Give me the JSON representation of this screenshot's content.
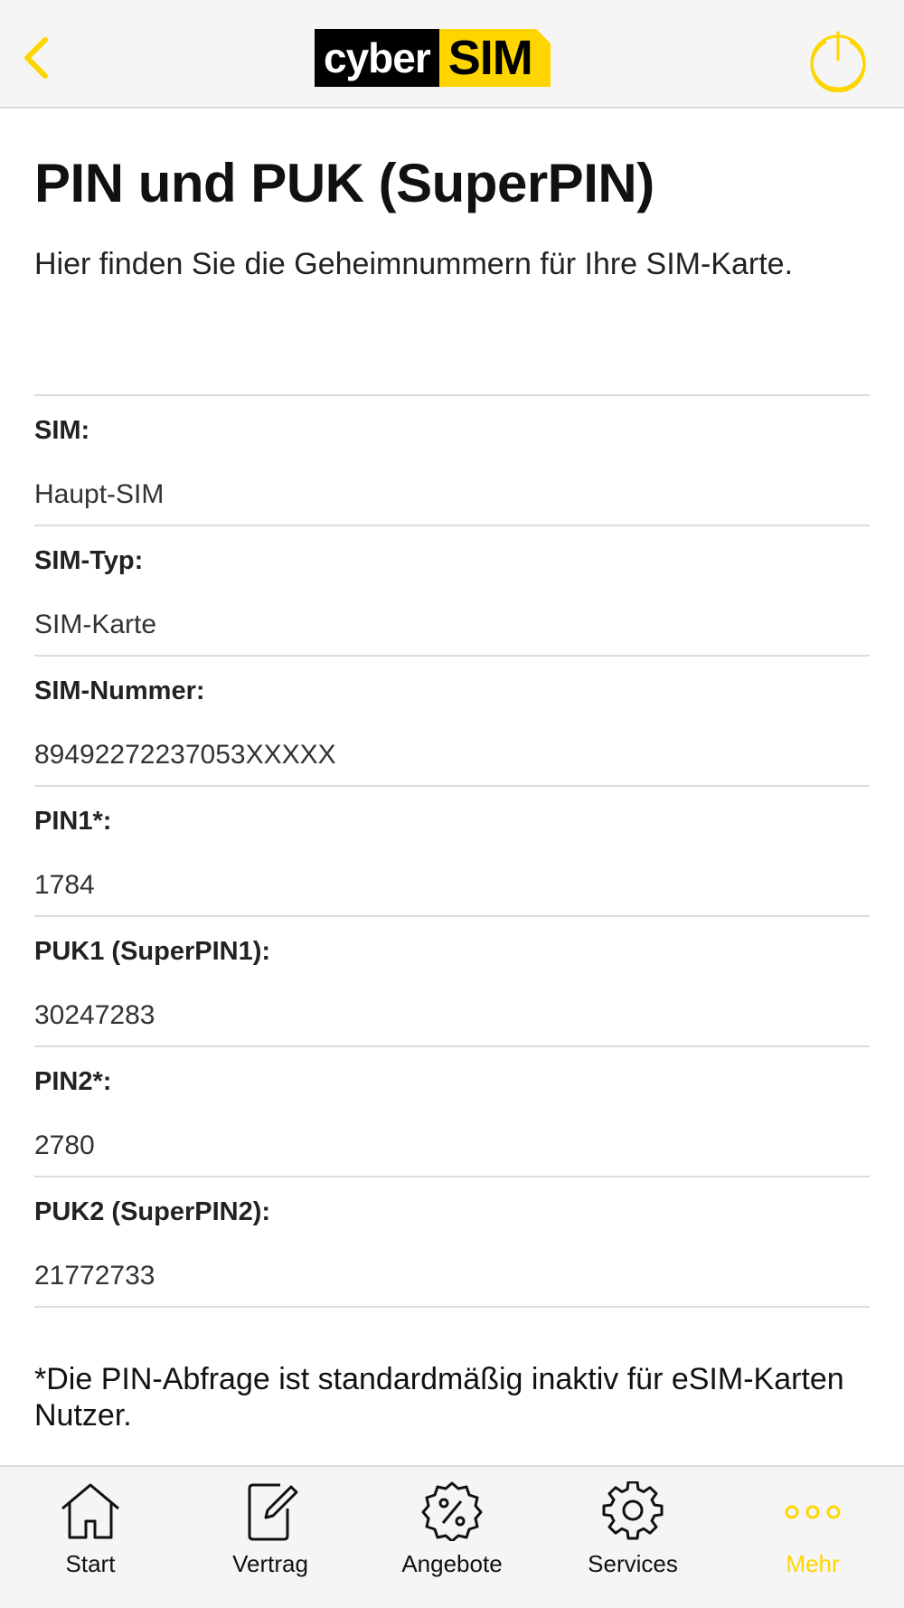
{
  "header": {
    "logo_cyber": "cyber",
    "logo_sim": "SIM",
    "accent_color": "#ffd500"
  },
  "page": {
    "title": "PIN und PUK (SuperPIN)",
    "intro": "Hier finden Sie die Geheimnummern für Ihre SIM-Karte."
  },
  "fields": [
    {
      "label": "SIM:",
      "value": "Haupt-SIM"
    },
    {
      "label": "SIM-Typ:",
      "value": "SIM-Karte"
    },
    {
      "label": "SIM-Nummer:",
      "value": "89492272237053XXXXX"
    },
    {
      "label": "PIN1*:",
      "value": "1784"
    },
    {
      "label": "PUK1 (SuperPIN1):",
      "value": "30247283"
    },
    {
      "label": "PIN2*:",
      "value": "2780"
    },
    {
      "label": "PUK2 (SuperPIN2):",
      "value": "21772733"
    }
  ],
  "footnote": "*Die PIN-Abfrage ist standardmäßig inaktiv für eSIM-Karten Nutzer.",
  "tabbar": {
    "items": [
      {
        "label": "Start",
        "icon": "home-icon"
      },
      {
        "label": "Vertrag",
        "icon": "contract-icon"
      },
      {
        "label": "Angebote",
        "icon": "percent-badge-icon"
      },
      {
        "label": "Services",
        "icon": "gear-icon"
      },
      {
        "label": "Mehr",
        "icon": "more-dots-icon",
        "active": true
      }
    ]
  }
}
